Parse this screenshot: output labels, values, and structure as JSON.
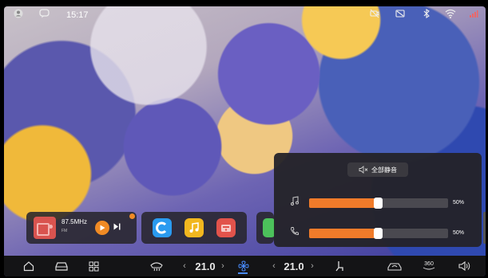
{
  "status_bar": {
    "time": "15:17",
    "left_icons": [
      "user-icon",
      "chat-icon"
    ],
    "right_icons": [
      "no-camera-icon",
      "no-screen-icon",
      "bluetooth-icon",
      "wifi-icon",
      "signal-icon"
    ]
  },
  "radio_widget": {
    "frequency": "87.5MHz",
    "band": "FM",
    "thumb_icon": "radio-icon",
    "play_icon": "play-icon",
    "next_icon": "next-track-icon",
    "accent": "#f08a24"
  },
  "app_shortcuts": [
    {
      "name": "app-c",
      "icon": "c-logo-icon",
      "color": "#2a9bf0",
      "glyph": "C"
    },
    {
      "name": "music-app",
      "icon": "music-note-icon",
      "color": "#f2b71f",
      "glyph": "♫"
    },
    {
      "name": "radio-app",
      "icon": "radio-icon",
      "color": "#e2534b",
      "glyph": "▤"
    }
  ],
  "volume_panel": {
    "mute_all_label": "全部静音",
    "media": {
      "icon": "music-note-icon",
      "level": 50,
      "percent_label": "50%"
    },
    "call": {
      "icon": "phone-icon",
      "level": 50,
      "percent_label": "50%"
    },
    "accent": "#f07b2a"
  },
  "dock": {
    "left_temp": "21.0",
    "right_temp": "21.0",
    "items": [
      "home-icon",
      "car-icon",
      "apps-grid-icon",
      "defrost-icon",
      "fan-icon",
      "seat-icon",
      "recirculation-icon",
      "camera-360-icon",
      "volume-icon"
    ],
    "cam_label": "360"
  }
}
